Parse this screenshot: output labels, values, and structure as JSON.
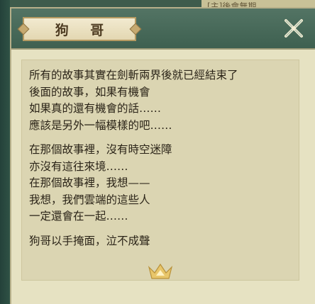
{
  "background": {
    "top_right_label": "[主]後會無期"
  },
  "dialog": {
    "title": "狗 哥",
    "paragraphs": [
      [
        "所有的故事其實在劍斬兩界後就已經結束了",
        "後面的故事，如果有機會",
        "如果真的還有機會的話……",
        "應該是另外一幅模樣的吧……"
      ],
      [
        "在那個故事裡，沒有時空迷障",
        "亦沒有這往來境……",
        "在那個故事裡，我想——",
        "我想，我們雲端的這些人",
        "一定還會在一起……"
      ],
      [
        "狗哥以手掩面，泣不成聲"
      ]
    ]
  },
  "icons": {
    "close": "close-x-icon",
    "ornament": "crown-ornament-icon"
  },
  "colors": {
    "panel_bg": "#e6e2c2",
    "header_bg": "#3e6050",
    "text": "#2b2418",
    "close_icon": "#f2ecd2",
    "ornament": "#e8c66a"
  }
}
